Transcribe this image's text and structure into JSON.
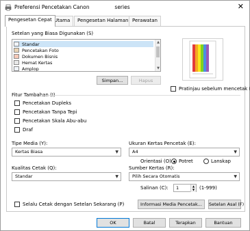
{
  "window": {
    "title": "Preferensi Pencetakan Canon",
    "title_suffix": "series",
    "close_glyph": "✕",
    "icon": "printer-icon"
  },
  "tabs": [
    {
      "label": "Pengesetan Cepat",
      "active": true
    },
    {
      "label": "Utama",
      "active": false
    },
    {
      "label": "Pengesetan Halaman",
      "active": false
    },
    {
      "label": "Perawatan",
      "active": false
    }
  ],
  "common_settings": {
    "label": "Setelan yang Biasa Digunakan (S)",
    "items": [
      {
        "label": "Standar",
        "selected": true
      },
      {
        "label": "Pencetakan Foto",
        "selected": false
      },
      {
        "label": "Dokumen Bisnis",
        "selected": false
      },
      {
        "label": "Hemat Kertas",
        "selected": false
      },
      {
        "label": "Amplop",
        "selected": false
      }
    ],
    "save_button": "Simpan...",
    "delete_button": "Hapus"
  },
  "preview": {
    "checkbox_label": "Pratinjau sebelum mencetak (W)",
    "checked": false,
    "stripe_colors": [
      "#e33a3a",
      "#f5a623",
      "#f8e71c",
      "#7ed321",
      "#4a90e2",
      "#9b59b6"
    ]
  },
  "additional": {
    "label": "Fitur Tambahan (I)",
    "options": [
      {
        "label": "Pencetakan Dupleks",
        "checked": false
      },
      {
        "label": "Pencetakan Tanpa Tepi",
        "checked": false
      },
      {
        "label": "Pencetakan Skala Abu-abu",
        "checked": false
      },
      {
        "label": "Draf",
        "checked": false
      }
    ]
  },
  "media_type": {
    "label": "Tipe Media (Y):",
    "value": "Kertas Biasa"
  },
  "print_quality": {
    "label": "Kualitas Cetak (Q):",
    "value": "Standar"
  },
  "paper_size": {
    "label": "Ukuran Kertas Pencetak (E):",
    "value": "A4"
  },
  "orientation": {
    "label": "Orientasi (O):",
    "options": [
      {
        "label": "Potret",
        "selected": true
      },
      {
        "label": "Lanskap",
        "selected": false
      }
    ]
  },
  "paper_source": {
    "label": "Sumber Kertas (R):",
    "value": "Pilih Secara Otomatis"
  },
  "copies": {
    "label": "Salinan (C):",
    "value": "1",
    "range": "(1-999)"
  },
  "always_print_checkbox": {
    "label": "Selalu Cetak dengan Setelan Sekarang (P)",
    "checked": false
  },
  "media_info_button": "Informasi Media Pencetak...",
  "defaults_button": "Setelan Asal (F)",
  "footer": {
    "ok": "OK",
    "cancel": "Batal",
    "apply": "Terapkan",
    "help": "Bantuan"
  },
  "colors": {
    "accent": "#0078d7",
    "selection": "#cce4f7"
  }
}
